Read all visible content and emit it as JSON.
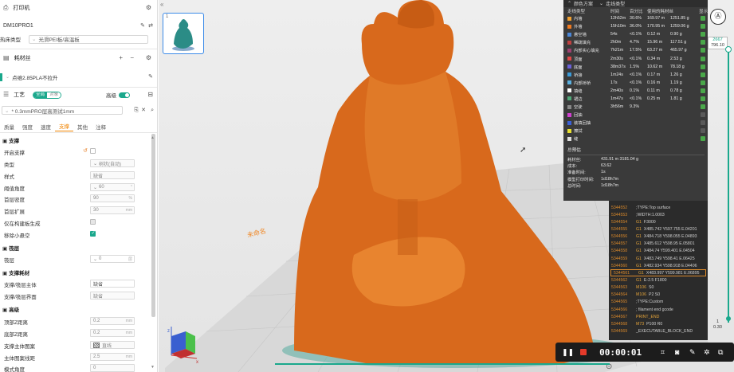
{
  "printer": {
    "section_title": "打印机",
    "name": "DM10PRO1",
    "plate_label": "热床类型",
    "plate_value": "光滑PEI板/高温板"
  },
  "filament": {
    "section_title": "耗材丝",
    "item": "点维2.85PLA不拉升"
  },
  "process": {
    "section_title": "工艺",
    "toggle_global": "全局",
    "toggle_object": "对象",
    "advanced_label": "高级",
    "preset_name": "* 0.3mmPRO层高测试1mm",
    "tabs": [
      "质量",
      "强度",
      "速度",
      "支撑",
      "其他",
      "注释"
    ],
    "active_tab": "支撑"
  },
  "support": {
    "group_support": "支撑",
    "enable_label": "开启支撑",
    "type_label": "类型",
    "type_value": "树状(自动)",
    "style_label": "样式",
    "style_value": "缺省",
    "threshold_label": "阈值角度",
    "threshold_value": "60",
    "threshold_unit": "°",
    "first_density_label": "首层密度",
    "first_density_value": "90",
    "first_density_unit": "%",
    "first_expand_label": "首层扩展",
    "first_expand_value": "30",
    "first_expand_unit": "mm",
    "buildplate_only_label": "仅在构建板生成",
    "remove_small_label": "移除小悬空",
    "group_raft": "筏层",
    "raft_label": "筏层",
    "raft_value": "0",
    "raft_unit": "层",
    "group_material": "支撑耗材",
    "base_label": "支撑/筏层主体",
    "base_value": "缺省",
    "interface_label": "支撑/筏层界面",
    "interface_value": "缺省",
    "group_advanced": "高级",
    "top_z_label": "顶部Z距离",
    "top_z_value": "0.2",
    "top_z_unit": "mm",
    "bottom_z_label": "底部Z距离",
    "bottom_z_value": "0.2",
    "bottom_z_unit": "mm",
    "base_pattern_label": "支撑主体图案",
    "base_pattern_value": "直线",
    "base_spacing_label": "主体图案线距",
    "base_spacing_value": "2.5",
    "base_spacing_unit": "mm",
    "pattern_angle_label": "模式角度",
    "pattern_angle_value": "0"
  },
  "viewport": {
    "thumb_index": "1",
    "plate_label": "未命名"
  },
  "legend": {
    "header": "颜色方案",
    "scheme": "走线类型",
    "columns": [
      "走线类型",
      "时间",
      "百分比",
      "使用的耗材丝",
      "显示"
    ],
    "rows": [
      {
        "name": "内墙",
        "color": "#f0a030",
        "time": "12h52m",
        "pct": "30.6%",
        "len": "169.97 m",
        "weight": "1251.85 g",
        "visible": true
      },
      {
        "name": "外墙",
        "color": "#f07a20",
        "time": "15h10m",
        "pct": "36.0%",
        "len": "170.95 m",
        "weight": "1259.06 g",
        "visible": true
      },
      {
        "name": "悬空墙",
        "color": "#4a86d8",
        "time": "54s",
        "pct": "<0.1%",
        "len": "0.12 m",
        "weight": "0.90 g",
        "visible": true
      },
      {
        "name": "稀疏填充",
        "color": "#c04040",
        "time": "2h0m",
        "pct": "4.7%",
        "len": "15.96 m",
        "weight": "117.51 g",
        "visible": true
      },
      {
        "name": "内部实心填充",
        "color": "#a04070",
        "time": "7h21m",
        "pct": "17.5%",
        "len": "63.27 m",
        "weight": "465.97 g",
        "visible": true
      },
      {
        "name": "顶面",
        "color": "#e04848",
        "time": "2m30s",
        "pct": "<0.1%",
        "len": "0.34 m",
        "weight": "2.53 g",
        "visible": true
      },
      {
        "name": "底面",
        "color": "#6a60d8",
        "time": "38m37s",
        "pct": "1.5%",
        "len": "10.62 m",
        "weight": "78.18 g",
        "visible": true
      },
      {
        "name": "桥接",
        "color": "#3a9ad8",
        "time": "1m24s",
        "pct": "<0.1%",
        "len": "0.17 m",
        "weight": "1.26 g",
        "visible": true
      },
      {
        "name": "内部桥桥",
        "color": "#5ab0e0",
        "time": "17s",
        "pct": "<0.1%",
        "len": "0.16 m",
        "weight": "1.19 g",
        "visible": true
      },
      {
        "name": "填缝",
        "color": "#ffffff",
        "time": "2m40s",
        "pct": "0.1%",
        "len": "0.11 m",
        "weight": "0.78 g",
        "visible": true
      },
      {
        "name": "裙边",
        "color": "#50a878",
        "time": "1m47s",
        "pct": "<0.1%",
        "len": "0.25 m",
        "weight": "1.81 g",
        "visible": true
      },
      {
        "name": "空驶",
        "color": "#888888",
        "time": "3h56m",
        "pct": "9.3%",
        "len": "",
        "weight": "",
        "visible": true
      },
      {
        "name": "回抽",
        "color": "#d040d0",
        "time": "",
        "pct": "",
        "len": "",
        "weight": "",
        "visible": false
      },
      {
        "name": "装填回抽",
        "color": "#3a60d8",
        "time": "",
        "pct": "",
        "len": "",
        "weight": "",
        "visible": false
      },
      {
        "name": "擦拭",
        "color": "#e8e030",
        "time": "",
        "pct": "",
        "len": "",
        "weight": "",
        "visible": false
      },
      {
        "name": "缝",
        "color": "#dddddd",
        "time": "",
        "pct": "",
        "len": "",
        "weight": "",
        "visible": true
      }
    ],
    "summary_title": "总预估",
    "summary": [
      {
        "k": "耗材丝:",
        "v": "431.91 m    3181.04 g"
      },
      {
        "k": "成本:",
        "v": "63.62"
      },
      {
        "k": "准备时间:",
        "v": "1s"
      },
      {
        "k": "模型打印时间:",
        "v": "1d18h7m"
      },
      {
        "k": "总时间:",
        "v": "1d18h7m"
      }
    ]
  },
  "gcode": [
    {
      "n": "5344552",
      "cmd": "",
      "txt": ";TYPE:Top surface",
      "hl": false
    },
    {
      "n": "5344553",
      "cmd": "",
      "txt": ";WIDTH:1.0003",
      "hl": false
    },
    {
      "n": "5344554",
      "cmd": "G1",
      "txt": "F3000",
      "hl": false
    },
    {
      "n": "5344555",
      "cmd": "G1",
      "txt": "X485.742 Y597.755 E.04201",
      "hl": false
    },
    {
      "n": "5344556",
      "cmd": "G1",
      "txt": "X484.718 Y598.055 E.04893",
      "hl": false
    },
    {
      "n": "5344557",
      "cmd": "G1",
      "txt": "X485.612 Y598.95 E.05801",
      "hl": false
    },
    {
      "n": "5344558",
      "cmd": "G1",
      "txt": "X484.74 Y599.401 E.04504",
      "hl": false
    },
    {
      "n": "5344559",
      "cmd": "G1",
      "txt": "X483.749 Y598.41 E.06425",
      "hl": false
    },
    {
      "n": "5344560",
      "cmd": "G1",
      "txt": "X482.934 Y598.918 E.04406",
      "hl": false
    },
    {
      "n": "5344561",
      "cmd": "G1",
      "txt": "X483.997 Y599.981 E.06895",
      "hl": true
    },
    {
      "n": "5344562",
      "cmd": "G1",
      "txt": "E-2.5 F1800",
      "hl": false
    },
    {
      "n": "5344563",
      "cmd": "M106",
      "txt": "S0",
      "hl": false
    },
    {
      "n": "5344564",
      "cmd": "M106",
      "txt": "P2 S0",
      "hl": false
    },
    {
      "n": "5344565",
      "cmd": "",
      "txt": ";TYPE:Custom",
      "hl": false
    },
    {
      "n": "5344566",
      "cmd": "",
      "txt": "; filament end gcode",
      "hl": false
    },
    {
      "n": "5344567",
      "cmd": "PRINT_END",
      "txt": "",
      "hl": false
    },
    {
      "n": "5344568",
      "cmd": "M73",
      "txt": "P100 R0",
      "hl": false
    },
    {
      "n": "5344569",
      "cmd": "",
      "txt": "_EXECUTABLE_BLOCK_END",
      "hl": false
    }
  ],
  "layer_slider": {
    "top_value": "2667",
    "top_height": "796.10",
    "bottom_value": "1",
    "bottom_height": "0.30"
  },
  "recorder": {
    "timer": "00:00:01"
  }
}
